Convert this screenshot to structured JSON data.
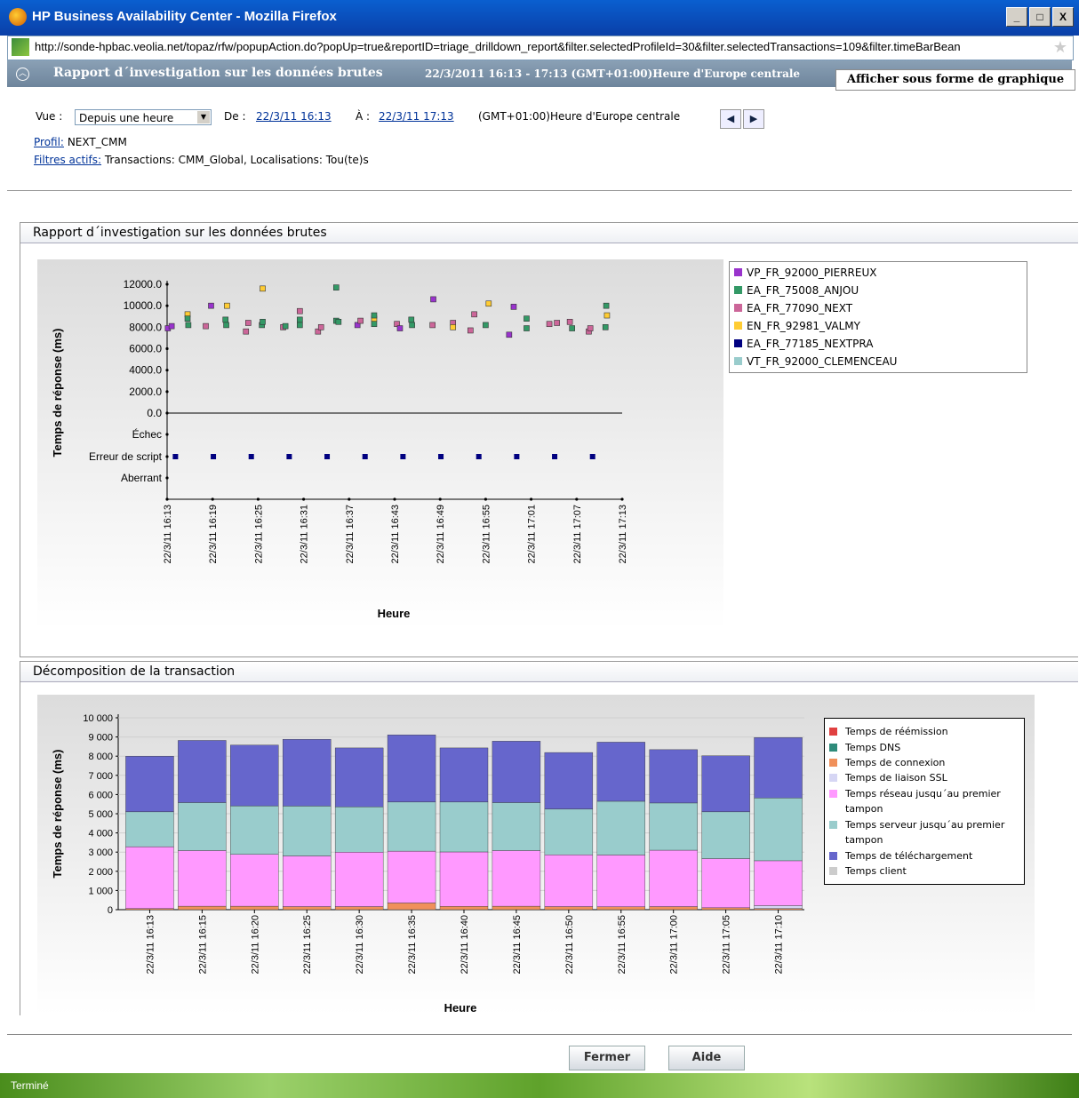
{
  "window": {
    "title": "HP Business Availability Center - Mozilla Firefox",
    "buttons": [
      "_",
      "□",
      "X"
    ]
  },
  "url": "http://sonde-hpbac.veolia.net/topaz/rfw/popupAction.do?popUp=true&reportID=triage_drilldown_report&filter.selectedProfileId=30&filter.selectedTransactions=109&filter.timeBarBean",
  "header": {
    "title": "Rapport d´investigation sur les données brutes",
    "time_range": "22/3/2011 16:13 - 17:13 (GMT+01:00)Heure d'Europe centrale",
    "graph_tab": "Afficher sous forme de graphique"
  },
  "filters": {
    "view_label": "Vue :",
    "view_value": "Depuis une heure",
    "from_label": "De :",
    "from_value": "22/3/11 16:13",
    "to_label": "À :",
    "to_value": "22/3/11 17:13",
    "timezone": "(GMT+01:00)Heure d'Europe centrale",
    "profile_label": "Profil:",
    "profile_value": "NEXT_CMM",
    "active_filters_label": "Filtres actifs:",
    "active_filters_value": "Transactions: CMM_Global, Localisations: Tou(te)s"
  },
  "panel1": {
    "title": "Rapport d´investigation sur les données brutes"
  },
  "panel2": {
    "title": "Décomposition de la transaction"
  },
  "chart_data": [
    {
      "type": "scatter",
      "title": "",
      "ylabel": "Temps de réponse (ms)",
      "xlabel": "Heure",
      "ylim": [
        0,
        12000
      ],
      "y_ticks": [
        "12000.0",
        "10000.0",
        "8000.0",
        "6000.0",
        "4000.0",
        "2000.0",
        "0.0"
      ],
      "y_categories": [
        "Échec",
        "Erreur de script",
        "Aberrant"
      ],
      "x_ticks": [
        "22/3/11 16:13",
        "22/3/11 16:19",
        "22/3/11 16:25",
        "22/3/11 16:31",
        "22/3/11 16:37",
        "22/3/11 16:43",
        "22/3/11 16:49",
        "22/3/11 16:55",
        "22/3/11 17:01",
        "22/3/11 17:07",
        "22/3/11 17:13"
      ],
      "legend": [
        {
          "name": "VP_FR_92000_PIERREUX",
          "color": "#9933cc"
        },
        {
          "name": "EA_FR_75008_ANJOU",
          "color": "#339966"
        },
        {
          "name": "EA_FR_77090_NEXT",
          "color": "#cc6699"
        },
        {
          "name": "EN_FR_92981_VALMY",
          "color": "#ffcc33"
        },
        {
          "name": "EA_FR_77185_NEXTPRA",
          "color": "#000080"
        },
        {
          "name": "VT_FR_92000_CLEMENCEAU",
          "color": "#99cccc"
        }
      ],
      "points": [
        {
          "s": 0,
          "x": 0.1,
          "y": 7900
        },
        {
          "s": 0,
          "x": 0.6,
          "y": 8100
        },
        {
          "s": 3,
          "x": 2.7,
          "y": 9200
        },
        {
          "s": 1,
          "x": 2.7,
          "y": 8800
        },
        {
          "s": 1,
          "x": 2.8,
          "y": 8200
        },
        {
          "s": 2,
          "x": 5.1,
          "y": 8100
        },
        {
          "s": 0,
          "x": 5.8,
          "y": 10000
        },
        {
          "s": 3,
          "x": 7.9,
          "y": 10000
        },
        {
          "s": 1,
          "x": 7.7,
          "y": 8700
        },
        {
          "s": 1,
          "x": 7.8,
          "y": 8200
        },
        {
          "s": 2,
          "x": 10.4,
          "y": 7600
        },
        {
          "s": 2,
          "x": 10.7,
          "y": 8400
        },
        {
          "s": 1,
          "x": 12.5,
          "y": 8200
        },
        {
          "s": 3,
          "x": 12.6,
          "y": 11600
        },
        {
          "s": 1,
          "x": 12.6,
          "y": 8500
        },
        {
          "s": 2,
          "x": 15.3,
          "y": 8000
        },
        {
          "s": 1,
          "x": 15.6,
          "y": 8100
        },
        {
          "s": 2,
          "x": 17.5,
          "y": 9500
        },
        {
          "s": 1,
          "x": 17.5,
          "y": 8700
        },
        {
          "s": 1,
          "x": 17.5,
          "y": 8200
        },
        {
          "s": 2,
          "x": 19.9,
          "y": 7600
        },
        {
          "s": 2,
          "x": 20.3,
          "y": 8000
        },
        {
          "s": 1,
          "x": 22.3,
          "y": 11700
        },
        {
          "s": 1,
          "x": 22.3,
          "y": 8600
        },
        {
          "s": 1,
          "x": 22.6,
          "y": 8500
        },
        {
          "s": 0,
          "x": 25.1,
          "y": 8200
        },
        {
          "s": 2,
          "x": 25.5,
          "y": 8600
        },
        {
          "s": 1,
          "x": 27.3,
          "y": 8300
        },
        {
          "s": 3,
          "x": 27.3,
          "y": 8800
        },
        {
          "s": 1,
          "x": 27.3,
          "y": 9100
        },
        {
          "s": 2,
          "x": 30.3,
          "y": 8300
        },
        {
          "s": 0,
          "x": 30.7,
          "y": 7900
        },
        {
          "s": 1,
          "x": 32.2,
          "y": 8700
        },
        {
          "s": 1,
          "x": 32.3,
          "y": 8200
        },
        {
          "s": 0,
          "x": 35.1,
          "y": 10600
        },
        {
          "s": 2,
          "x": 35.0,
          "y": 8200
        },
        {
          "s": 2,
          "x": 37.7,
          "y": 8400
        },
        {
          "s": 3,
          "x": 37.7,
          "y": 8000
        },
        {
          "s": 2,
          "x": 40.0,
          "y": 7700
        },
        {
          "s": 2,
          "x": 40.5,
          "y": 9200
        },
        {
          "s": 1,
          "x": 42.0,
          "y": 8200
        },
        {
          "s": 3,
          "x": 42.4,
          "y": 10200
        },
        {
          "s": 0,
          "x": 45.1,
          "y": 7300
        },
        {
          "s": 0,
          "x": 45.7,
          "y": 9900
        },
        {
          "s": 1,
          "x": 47.4,
          "y": 8800
        },
        {
          "s": 1,
          "x": 47.4,
          "y": 7900
        },
        {
          "s": 2,
          "x": 50.4,
          "y": 8300
        },
        {
          "s": 2,
          "x": 51.4,
          "y": 8400
        },
        {
          "s": 2,
          "x": 53.1,
          "y": 8500
        },
        {
          "s": 1,
          "x": 53.4,
          "y": 7900
        },
        {
          "s": 2,
          "x": 55.6,
          "y": 7600
        },
        {
          "s": 2,
          "x": 55.8,
          "y": 7900
        },
        {
          "s": 1,
          "x": 57.8,
          "y": 8000
        },
        {
          "s": 1,
          "x": 57.9,
          "y": 10000
        },
        {
          "s": 3,
          "x": 58.0,
          "y": 9100
        }
      ],
      "error_points_x": [
        1.1,
        6.1,
        11.1,
        16.1,
        21.1,
        26.1,
        31.1,
        36.1,
        41.1,
        46.1,
        51.1,
        56.1
      ]
    },
    {
      "type": "bar",
      "stacked": true,
      "title": "",
      "ylabel": "Temps de réponse (ms)",
      "xlabel": "Heure",
      "ylim": [
        0,
        10000
      ],
      "y_ticks": [
        "10 000",
        "9 000",
        "8 000",
        "7 000",
        "6 000",
        "5 000",
        "4 000",
        "3 000",
        "2 000",
        "1 000",
        "0"
      ],
      "categories": [
        "22/3/11 16:13",
        "22/3/11 16:15",
        "22/3/11 16:20",
        "22/3/11 16:25",
        "22/3/11 16:30",
        "22/3/11 16:35",
        "22/3/11 16:40",
        "22/3/11 16:45",
        "22/3/11 16:50",
        "22/3/11 16:55",
        "22/3/11 17:00",
        "22/3/11 17:05",
        "22/3/11 17:10"
      ],
      "series": [
        {
          "name": "Temps de réémission",
          "color": "#e04040",
          "values": [
            0,
            0,
            0,
            0,
            0,
            0,
            0,
            0,
            0,
            0,
            0,
            0,
            0
          ]
        },
        {
          "name": "Temps DNS",
          "color": "#2e8b7a",
          "values": [
            0,
            0,
            0,
            0,
            0,
            0,
            0,
            0,
            0,
            0,
            0,
            0,
            0
          ]
        },
        {
          "name": "Temps de connexion",
          "color": "#f0905a",
          "values": [
            60,
            180,
            180,
            160,
            160,
            350,
            170,
            180,
            160,
            150,
            160,
            100,
            60
          ]
        },
        {
          "name": "Temps de liaison SSL",
          "color": "#d6d6f4",
          "values": [
            0,
            0,
            0,
            0,
            0,
            0,
            0,
            0,
            0,
            0,
            0,
            0,
            150
          ]
        },
        {
          "name": "Temps réseau jusqu´au premier tampon",
          "color": "#ff99ff",
          "values": [
            3220,
            2900,
            2700,
            2640,
            2840,
            2700,
            2840,
            2900,
            2700,
            2700,
            2940,
            2560,
            2340
          ]
        },
        {
          "name": "Temps serveur jusqu´au premier tampon",
          "color": "#99cccc",
          "values": [
            1820,
            2500,
            2530,
            2600,
            2360,
            2560,
            2600,
            2500,
            2380,
            2800,
            2460,
            2440,
            3270
          ]
        },
        {
          "name": "Temps de téléchargement",
          "color": "#6666cc",
          "values": [
            2900,
            3240,
            3170,
            3480,
            3070,
            3500,
            2820,
            3200,
            2950,
            3080,
            2780,
            2920,
            3150
          ]
        },
        {
          "name": "Temps client",
          "color": "#cccccc",
          "values": [
            0,
            0,
            0,
            0,
            0,
            0,
            0,
            0,
            0,
            0,
            0,
            0,
            0
          ]
        }
      ]
    }
  ],
  "footer": {
    "close_button": "Fermer",
    "help_button": "Aide"
  },
  "status": "Terminé"
}
